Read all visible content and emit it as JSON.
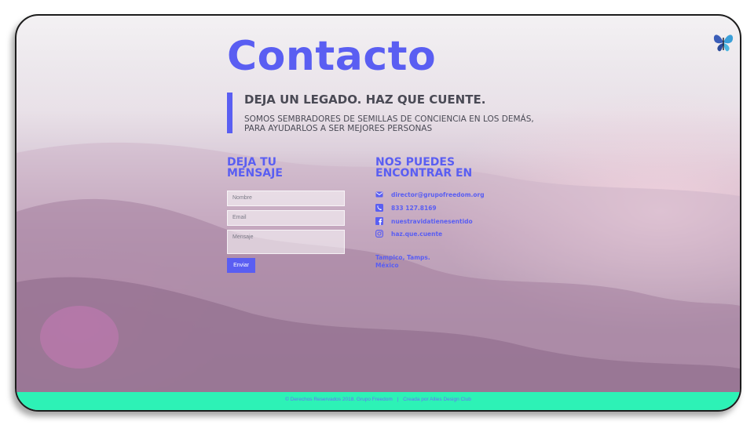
{
  "colors": {
    "accent": "#5a5ef2",
    "footer_bg": "#2df2b6"
  },
  "header": {
    "title": "Contacto",
    "tagline": "DEJA UN LEGADO. HAZ QUE CUENTE.",
    "subtitle": "SOMOS SEMBRADORES DE SEMILLAS DE CONCIENCIA EN LOS DEMÁS, PARA AYUDARLOS A SER MEJORES PERSONAS"
  },
  "logo": {
    "icon": "butterfly-icon"
  },
  "form": {
    "title": "DEJA TU\nMENSAJE",
    "name_placeholder": "Nombre",
    "email_placeholder": "Email",
    "message_placeholder": "Mensaje",
    "submit_label": "Enviar"
  },
  "contact": {
    "title": "NOS PUEDES\nENCONTRAR EN",
    "items": [
      {
        "icon": "email-icon",
        "text": "director@grupofreedom.org"
      },
      {
        "icon": "phone-icon",
        "text": "833 127.8169"
      },
      {
        "icon": "facebook-icon",
        "text": "nuestravidatienesentido"
      },
      {
        "icon": "instagram-icon",
        "text": "haz.que.cuente"
      }
    ],
    "city": "Tampico, Tamps.",
    "country": "México"
  },
  "footer": {
    "copyright": "© Derechos Reservados 2018. Grupo Freedom",
    "separator": "|",
    "credit": "Creada por Allies Design Club"
  }
}
